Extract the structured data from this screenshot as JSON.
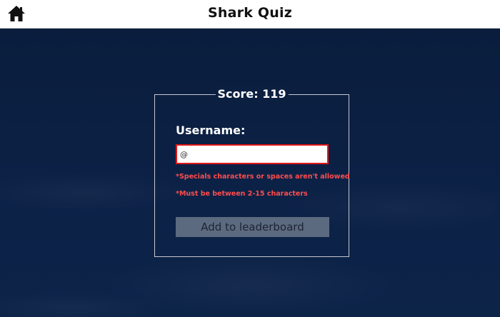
{
  "header": {
    "title": "Shark Quiz",
    "home_icon": "home-icon"
  },
  "quiz": {
    "score_label": "Score: 119",
    "username_label": "Username:",
    "username_value": "@",
    "errors": [
      "*Specials characters or spaces aren't allowed",
      "*Must be between 2-15 characters"
    ],
    "submit_label": "Add to leaderboard"
  },
  "colors": {
    "background": "#0b1f40",
    "header_bg": "#ffffff",
    "error": "#ff4d4d",
    "input_border_error": "#e01818",
    "button_bg": "#5c6a80"
  }
}
